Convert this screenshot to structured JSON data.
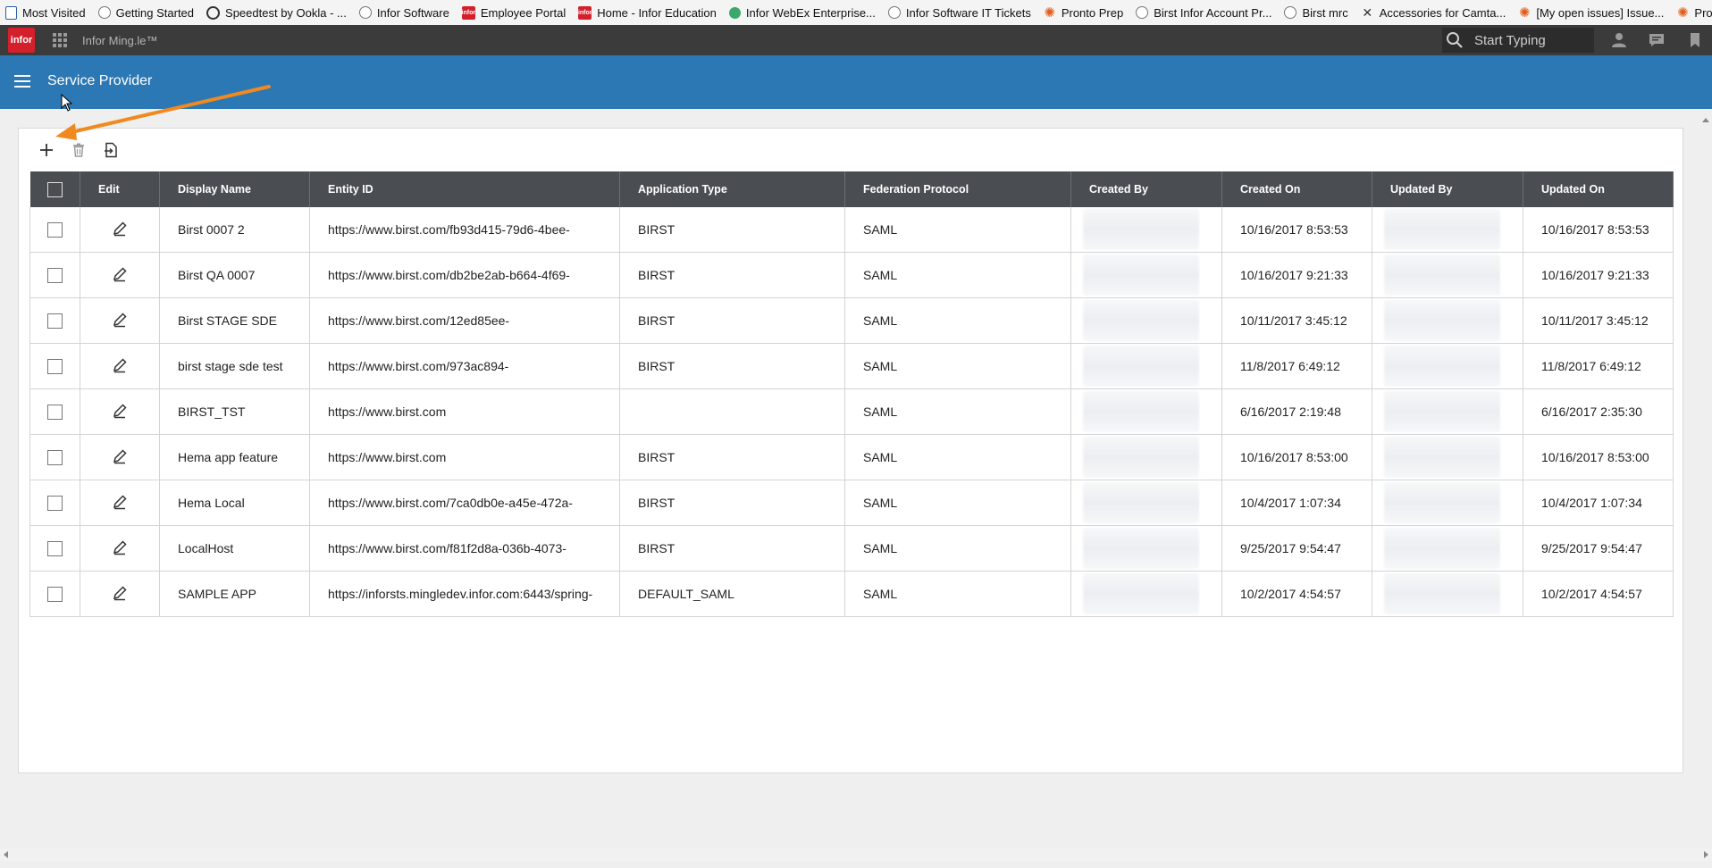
{
  "bookmarks": [
    {
      "label": "Most Visited",
      "icon": "doc-icon"
    },
    {
      "label": "Getting Started",
      "icon": "globe-icon"
    },
    {
      "label": "Speedtest by Ookla - ...",
      "icon": "gauge-icon"
    },
    {
      "label": "Infor Software",
      "icon": "globe-icon"
    },
    {
      "label": "Employee Portal",
      "icon": "infor-icon"
    },
    {
      "label": "Home - Infor Education",
      "icon": "infor-icon"
    },
    {
      "label": "Infor WebEx Enterprise...",
      "icon": "webex-icon"
    },
    {
      "label": "Infor Software IT Tickets",
      "icon": "globe-icon"
    },
    {
      "label": "Pronto Prep",
      "icon": "pinwheel-icon"
    },
    {
      "label": "Birst Infor Account Pr...",
      "icon": "globe-icon"
    },
    {
      "label": "Birst mrc",
      "icon": "globe-icon"
    },
    {
      "label": "Accessories for Camta...",
      "icon": "x-icon"
    },
    {
      "label": "[My open issues] Issue...",
      "icon": "pinwheel-icon"
    },
    {
      "label": "Pronto QA live",
      "icon": "pinwheel-icon"
    }
  ],
  "appbar": {
    "logo": "infor",
    "title": "Infor Ming.le™",
    "search_placeholder": "Start Typing"
  },
  "titlebar": {
    "title": "Service Provider"
  },
  "colors": {
    "brand_red": "#d4202b",
    "title_blue": "#2b78b5",
    "header_dark": "#3b3b3b",
    "table_header": "#4a4d52",
    "annotation_arrow": "#f08a1f"
  },
  "table": {
    "columns": [
      "",
      "Edit",
      "Display Name",
      "Entity ID",
      "Application Type",
      "Federation Protocol",
      "Created By",
      "Created On",
      "Updated By",
      "Updated On"
    ],
    "rows": [
      {
        "name": "Birst 0007 2",
        "entity": "https://www.birst.com/fb93d415-79d6-4bee-",
        "app": "BIRST",
        "protocol": "SAML",
        "created_on": "10/16/2017 8:53:53",
        "updated_on": "10/16/2017 8:53:53"
      },
      {
        "name": "Birst QA 0007",
        "entity": "https://www.birst.com/db2be2ab-b664-4f69-",
        "app": "BIRST",
        "protocol": "SAML",
        "created_on": "10/16/2017 9:21:33",
        "updated_on": "10/16/2017 9:21:33"
      },
      {
        "name": "Birst STAGE SDE",
        "entity": "https://www.birst.com/12ed85ee-",
        "app": "BIRST",
        "protocol": "SAML",
        "created_on": "10/11/2017 3:45:12",
        "updated_on": "10/11/2017 3:45:12"
      },
      {
        "name": "birst stage sde test",
        "entity": "https://www.birst.com/973ac894-",
        "app": "BIRST",
        "protocol": "SAML",
        "created_on": "11/8/2017 6:49:12",
        "updated_on": "11/8/2017 6:49:12"
      },
      {
        "name": "BIRST_TST",
        "entity": "https://www.birst.com",
        "app": "",
        "protocol": "SAML",
        "created_on": "6/16/2017 2:19:48",
        "updated_on": "6/16/2017 2:35:30"
      },
      {
        "name": "Hema app feature",
        "entity": "https://www.birst.com",
        "app": "BIRST",
        "protocol": "SAML",
        "created_on": "10/16/2017 8:53:00",
        "updated_on": "10/16/2017 8:53:00"
      },
      {
        "name": "Hema Local",
        "entity": "https://www.birst.com/7ca0db0e-a45e-472a-",
        "app": "BIRST",
        "protocol": "SAML",
        "created_on": "10/4/2017 1:07:34",
        "updated_on": "10/4/2017 1:07:34"
      },
      {
        "name": "LocalHost",
        "entity": "https://www.birst.com/f81f2d8a-036b-4073-",
        "app": "BIRST",
        "protocol": "SAML",
        "created_on": "9/25/2017 9:54:47",
        "updated_on": "9/25/2017 9:54:47"
      },
      {
        "name": "SAMPLE APP",
        "entity": "https://inforsts.mingledev.infor.com:6443/spring-",
        "app": "DEFAULT_SAML",
        "protocol": "SAML",
        "created_on": "10/2/2017 4:54:57",
        "updated_on": "10/2/2017 4:54:57"
      }
    ]
  }
}
